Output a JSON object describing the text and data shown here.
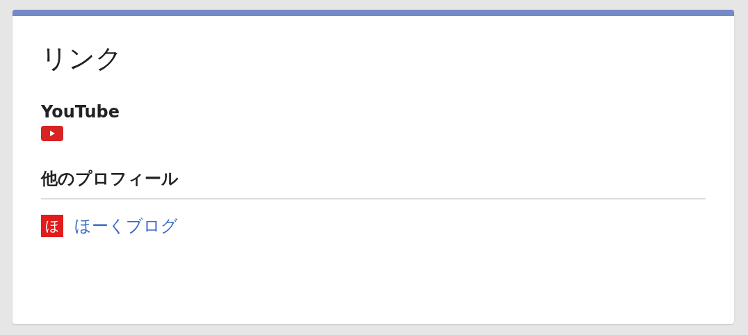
{
  "card": {
    "title": "リンク",
    "sections": [
      {
        "kind": "youtube",
        "heading": "YouTube"
      },
      {
        "kind": "profiles",
        "heading": "他のプロフィール",
        "links": [
          {
            "icon_text": "ほ",
            "label": "ほーくブログ"
          }
        ]
      }
    ]
  }
}
